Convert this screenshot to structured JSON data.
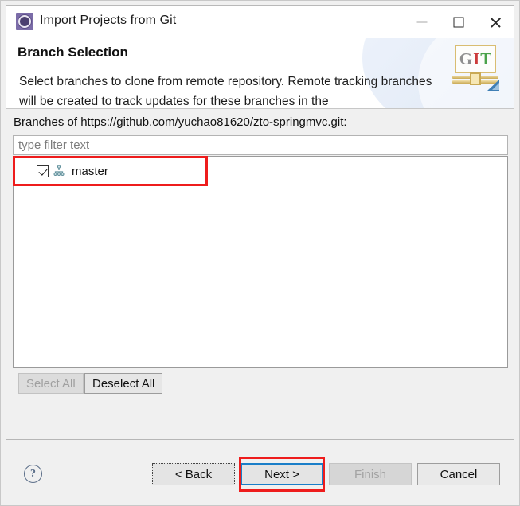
{
  "window": {
    "title": "Import Projects from Git",
    "icon": "eclipse-wizard-icon",
    "controls": {
      "minimize_label": "Minimize",
      "maximize_label": "Maximize",
      "close_label": "Close"
    }
  },
  "banner": {
    "title": "Branch Selection",
    "description": "Select branches to clone from remote repository. Remote tracking branches will be created to track updates for these branches in the",
    "logo_letters": [
      "G",
      "I",
      "T"
    ],
    "logo_colors": [
      "#8f8f8f",
      "#cc3b3b",
      "#4aa24a"
    ]
  },
  "content": {
    "branches_label": "Branches of https://github.com/yuchao81620/zto-springmvc.git:",
    "filter": {
      "value": "",
      "placeholder": "type filter text"
    },
    "branches": [
      {
        "name": "master",
        "checked": true,
        "icon": "git-branch-icon"
      }
    ],
    "buttons": {
      "select_all": "Select All",
      "select_all_enabled": false,
      "deselect_all": "Deselect All",
      "deselect_all_enabled": true
    }
  },
  "footer": {
    "help": "?",
    "back": "< Back",
    "next": "Next >",
    "finish": "Finish",
    "cancel": "Cancel",
    "finish_enabled": false,
    "next_focused": true
  },
  "annotations": {
    "color": "#ee1c1c",
    "targets": [
      "branch-row-master",
      "next-button"
    ]
  }
}
